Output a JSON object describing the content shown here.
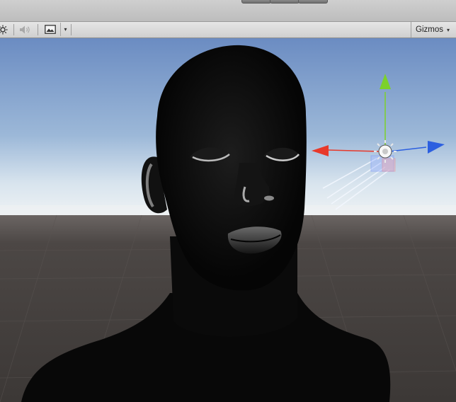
{
  "toolbar": {
    "gizmos_label": "Gizmos",
    "gizmos_arrow": "▾",
    "image_dropdown_arrow": "▾",
    "icons": [
      "sun-icon",
      "speaker-icon",
      "image-icon"
    ]
  },
  "colors": {
    "sky_top": "#6e8fc4",
    "horizon": "#e9eef2",
    "ground": "#3f3b39",
    "axis_x": "#e8392a",
    "axis_y": "#7cd12a",
    "axis_z": "#2c5fe0"
  }
}
